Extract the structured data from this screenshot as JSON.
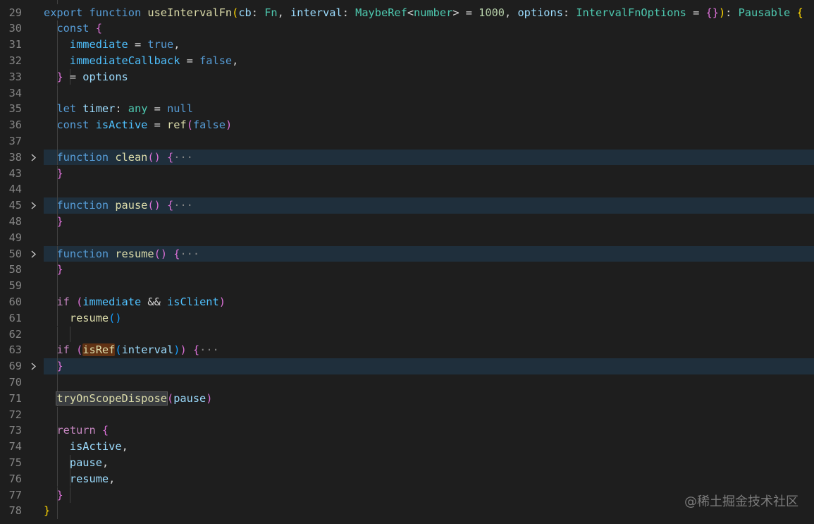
{
  "colors": {
    "background": "#1e1e1e",
    "line_number": "#858585",
    "keyword_storage": "#569cd6",
    "keyword_control": "#c586c0",
    "function": "#dcdcaa",
    "variable": "#9cdcfe",
    "constant": "#4fc1ff",
    "type": "#4ec9b0",
    "number": "#b5cea8",
    "text": "#d4d4d4",
    "bracket_gold": "#ffd700",
    "bracket_pink": "#da70d6",
    "bracket_blue": "#179fff",
    "fold_highlight": "#1f2f3c"
  },
  "icons": {
    "fold": "chevron-right-icon"
  },
  "watermark": "@稀土掘金技术社区",
  "lines": [
    {
      "num": "29",
      "tokens": [
        [
          "export",
          "#569cd6"
        ],
        [
          " ",
          "#d4d4d4"
        ],
        [
          "function",
          "#569cd6"
        ],
        [
          " ",
          "#d4d4d4"
        ],
        [
          "useIntervalFn",
          "#dcdcaa"
        ],
        [
          "(",
          "#ffd700"
        ],
        [
          "cb",
          "#9cdcfe"
        ],
        [
          ": ",
          "#d4d4d4"
        ],
        [
          "Fn",
          "#4ec9b0"
        ],
        [
          ", ",
          "#d4d4d4"
        ],
        [
          "interval",
          "#9cdcfe"
        ],
        [
          ": ",
          "#d4d4d4"
        ],
        [
          "MaybeRef",
          "#4ec9b0"
        ],
        [
          "<",
          "#d4d4d4"
        ],
        [
          "number",
          "#4ec9b0"
        ],
        [
          ">",
          "#d4d4d4"
        ],
        [
          " = ",
          "#d4d4d4"
        ],
        [
          "1000",
          "#b5cea8"
        ],
        [
          ", ",
          "#d4d4d4"
        ],
        [
          "options",
          "#9cdcfe"
        ],
        [
          ": ",
          "#d4d4d4"
        ],
        [
          "IntervalFnOptions",
          "#4ec9b0"
        ],
        [
          " = ",
          "#d4d4d4"
        ],
        [
          "{}",
          "#da70d6"
        ],
        [
          ")",
          "#ffd700"
        ],
        [
          ": ",
          "#d4d4d4"
        ],
        [
          "Pausable",
          "#4ec9b0"
        ],
        [
          " ",
          "#d4d4d4"
        ],
        [
          "{",
          "#ffd700"
        ]
      ]
    },
    {
      "num": "30",
      "tokens": [
        [
          "const",
          "#569cd6"
        ],
        [
          " ",
          "#d4d4d4"
        ],
        [
          "{",
          "#da70d6"
        ]
      ]
    },
    {
      "num": "31",
      "tokens": [
        [
          "immediate",
          "#4fc1ff"
        ],
        [
          " = ",
          "#d4d4d4"
        ],
        [
          "true",
          "#569cd6"
        ],
        [
          ",",
          "#d4d4d4"
        ]
      ]
    },
    {
      "num": "32",
      "tokens": [
        [
          "immediateCallback",
          "#4fc1ff"
        ],
        [
          " = ",
          "#d4d4d4"
        ],
        [
          "false",
          "#569cd6"
        ],
        [
          ",",
          "#d4d4d4"
        ]
      ]
    },
    {
      "num": "33",
      "tokens": [
        [
          "}",
          "#da70d6"
        ],
        [
          " = ",
          "#d4d4d4"
        ],
        [
          "options",
          "#9cdcfe"
        ]
      ]
    },
    {
      "num": "34",
      "tokens": []
    },
    {
      "num": "35",
      "tokens": [
        [
          "let",
          "#569cd6"
        ],
        [
          " ",
          "#d4d4d4"
        ],
        [
          "timer",
          "#9cdcfe"
        ],
        [
          ": ",
          "#d4d4d4"
        ],
        [
          "any",
          "#4ec9b0"
        ],
        [
          " = ",
          "#d4d4d4"
        ],
        [
          "null",
          "#569cd6"
        ]
      ]
    },
    {
      "num": "36",
      "tokens": [
        [
          "const",
          "#569cd6"
        ],
        [
          " ",
          "#d4d4d4"
        ],
        [
          "isActive",
          "#4fc1ff"
        ],
        [
          " = ",
          "#d4d4d4"
        ],
        [
          "ref",
          "#dcdcaa"
        ],
        [
          "(",
          "#da70d6"
        ],
        [
          "false",
          "#569cd6"
        ],
        [
          ")",
          "#da70d6"
        ]
      ]
    },
    {
      "num": "37",
      "tokens": []
    },
    {
      "num": "38",
      "tokens": [
        [
          "function",
          "#569cd6"
        ],
        [
          " ",
          "#d4d4d4"
        ],
        [
          "clean",
          "#dcdcaa"
        ],
        [
          "()",
          "#da70d6"
        ],
        [
          " ",
          "#d4d4d4"
        ],
        [
          "{",
          "#da70d6"
        ],
        [
          "···",
          "#858585"
        ]
      ]
    },
    {
      "num": "43",
      "tokens": [
        [
          "}",
          "#da70d6"
        ]
      ]
    },
    {
      "num": "44",
      "tokens": []
    },
    {
      "num": "45",
      "tokens": [
        [
          "function",
          "#569cd6"
        ],
        [
          " ",
          "#d4d4d4"
        ],
        [
          "pause",
          "#dcdcaa"
        ],
        [
          "()",
          "#da70d6"
        ],
        [
          " ",
          "#d4d4d4"
        ],
        [
          "{",
          "#da70d6"
        ],
        [
          "···",
          "#858585"
        ]
      ]
    },
    {
      "num": "48",
      "tokens": [
        [
          "}",
          "#da70d6"
        ]
      ]
    },
    {
      "num": "49",
      "tokens": []
    },
    {
      "num": "50",
      "tokens": [
        [
          "function",
          "#569cd6"
        ],
        [
          " ",
          "#d4d4d4"
        ],
        [
          "resume",
          "#dcdcaa"
        ],
        [
          "()",
          "#da70d6"
        ],
        [
          " ",
          "#d4d4d4"
        ],
        [
          "{",
          "#da70d6"
        ],
        [
          "···",
          "#858585"
        ]
      ]
    },
    {
      "num": "58",
      "tokens": [
        [
          "}",
          "#da70d6"
        ]
      ]
    },
    {
      "num": "59",
      "tokens": []
    },
    {
      "num": "60",
      "tokens": [
        [
          "if",
          "#c586c0"
        ],
        [
          " ",
          "#d4d4d4"
        ],
        [
          "(",
          "#da70d6"
        ],
        [
          "immediate",
          "#4fc1ff"
        ],
        [
          " && ",
          "#d4d4d4"
        ],
        [
          "isClient",
          "#4fc1ff"
        ],
        [
          ")",
          "#da70d6"
        ]
      ]
    },
    {
      "num": "61",
      "tokens": [
        [
          "resume",
          "#dcdcaa"
        ],
        [
          "()",
          "#179fff"
        ]
      ]
    },
    {
      "num": "62",
      "tokens": []
    },
    {
      "num": "63",
      "tokens": [
        [
          "if",
          "#c586c0"
        ],
        [
          " ",
          "#d4d4d4"
        ],
        [
          "(",
          "#da70d6"
        ],
        [
          "isRef",
          "#dcdcaa",
          "sel-ref"
        ],
        [
          "(",
          "#179fff"
        ],
        [
          "interval",
          "#9cdcfe"
        ],
        [
          ")",
          "#179fff"
        ],
        [
          ")",
          "#da70d6"
        ],
        [
          " ",
          "#d4d4d4"
        ],
        [
          "{",
          "#da70d6"
        ],
        [
          "···",
          "#858585"
        ]
      ]
    },
    {
      "num": "69",
      "tokens": [
        [
          "}",
          "#da70d6"
        ]
      ]
    },
    {
      "num": "70",
      "tokens": []
    },
    {
      "num": "71",
      "tokens": [
        [
          "tryOnScopeDispose",
          "#dcdcaa",
          "sel-try"
        ],
        [
          "(",
          "#da70d6"
        ],
        [
          "pause",
          "#9cdcfe"
        ],
        [
          ")",
          "#da70d6"
        ]
      ]
    },
    {
      "num": "72",
      "tokens": []
    },
    {
      "num": "73",
      "tokens": [
        [
          "return",
          "#c586c0"
        ],
        [
          " ",
          "#d4d4d4"
        ],
        [
          "{",
          "#da70d6"
        ]
      ]
    },
    {
      "num": "74",
      "tokens": [
        [
          "isActive",
          "#9cdcfe"
        ],
        [
          ",",
          "#d4d4d4"
        ]
      ]
    },
    {
      "num": "75",
      "tokens": [
        [
          "pause",
          "#9cdcfe"
        ],
        [
          ",",
          "#d4d4d4"
        ]
      ]
    },
    {
      "num": "76",
      "tokens": [
        [
          "resume",
          "#9cdcfe"
        ],
        [
          ",",
          "#d4d4d4"
        ]
      ]
    },
    {
      "num": "77",
      "tokens": [
        [
          "}",
          "#da70d6"
        ]
      ]
    },
    {
      "num": "78",
      "tokens": [
        [
          "}",
          "#ffd700"
        ]
      ]
    }
  ]
}
